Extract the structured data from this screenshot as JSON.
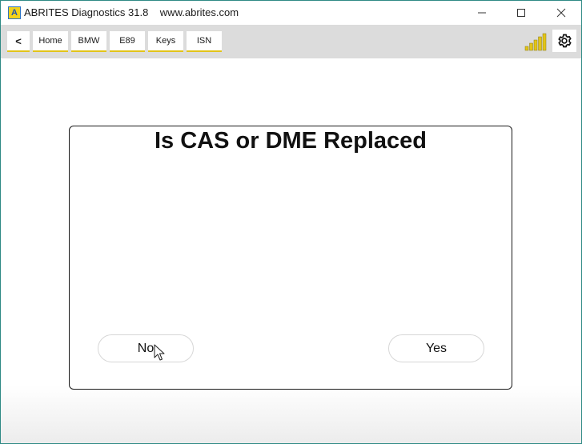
{
  "window": {
    "logo_letter": "A",
    "title": "ABRITES Diagnostics 31.8    www.abrites.com"
  },
  "toolbar": {
    "back_label": "<",
    "breadcrumbs": [
      "Home",
      "BMW",
      "E89",
      "Keys",
      "ISN"
    ]
  },
  "dialog": {
    "title": "Is CAS or DME Replaced",
    "no_label": "No",
    "yes_label": "Yes"
  },
  "colors": {
    "accent": "#e2c419",
    "toolbar_bg": "#dcdcdc",
    "window_border": "#2f8a85"
  },
  "icons": {
    "back": "chevron-left-icon",
    "signal": "signal-bars-icon",
    "settings": "gear-icon",
    "minimize": "minimize-icon",
    "maximize": "maximize-icon",
    "close": "close-icon"
  }
}
